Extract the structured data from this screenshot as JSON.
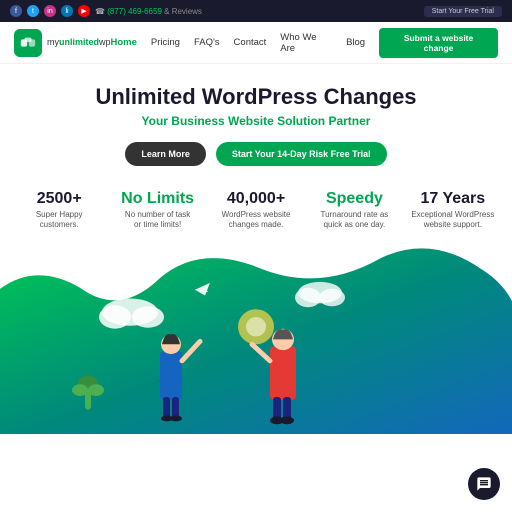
{
  "topbar": {
    "phone": "(877) 469-6659",
    "reviews": "& Reviews",
    "cta": "Start Your Free Trial"
  },
  "nav": {
    "logo_alt": "myunlimitedwp",
    "links": [
      {
        "label": "Home",
        "active": true
      },
      {
        "label": "Pricing",
        "active": false
      },
      {
        "label": "FAQ's",
        "active": false
      },
      {
        "label": "Contact",
        "active": false
      },
      {
        "label": "Who We Are",
        "active": false
      },
      {
        "label": "Blog",
        "active": false
      }
    ],
    "submit_btn": "Submit a website change"
  },
  "hero": {
    "title": "Unlimited WordPress Changes",
    "subtitle": "Your Business Website Solution Partner",
    "btn_learn": "Learn More",
    "btn_trial": "Start Your 14-Day Risk Free Trial"
  },
  "stats": [
    {
      "number": "2500+",
      "label": "Super Happy customers.",
      "green": false
    },
    {
      "number": "No Limits",
      "label": "No number of task or time limits!",
      "green": true
    },
    {
      "number": "40,000+",
      "label": "WordPress website changes made.",
      "green": false
    },
    {
      "number": "Speedy",
      "label": "Turnaround rate as quick as one day.",
      "green": true
    },
    {
      "number": "17 Years",
      "label": "Exceptional WordPress website support.",
      "green": false
    }
  ],
  "chat": {
    "label": "Chat"
  }
}
